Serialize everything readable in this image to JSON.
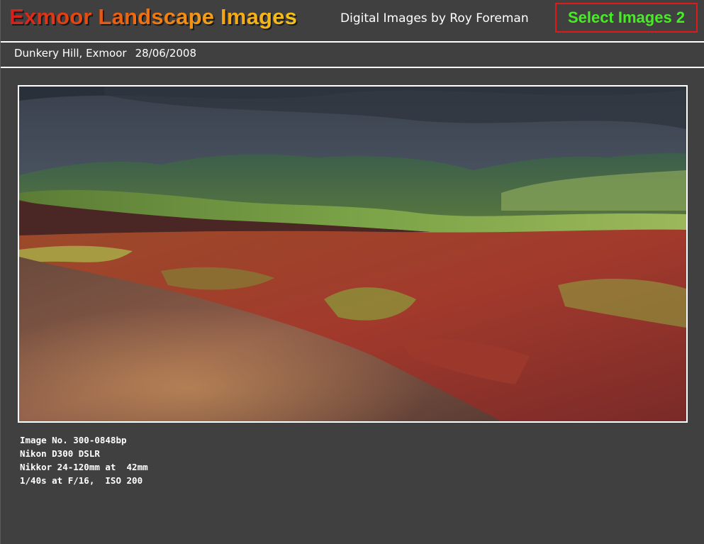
{
  "header": {
    "site_title": "Exmoor Landscape Images",
    "subtitle": "Digital Images by Roy Foreman",
    "select_button": "Select Images 2"
  },
  "location": {
    "place": "Dunkery Hill, Exmoor",
    "date": "28/06/2008"
  },
  "photo": {
    "subject": "landscape-photo"
  },
  "caption": {
    "lines": [
      "Image No. 300-0848bp",
      "Nikon D300 DSLR",
      "Nikkor 24-120mm at  42mm",
      "1/40s at F/16,  ISO 200"
    ]
  },
  "colors": {
    "background": "#404040",
    "button_text": "#44ee22",
    "button_border": "#e01a1a",
    "title_start": "#d81d1d",
    "title_end": "#f5c219"
  }
}
